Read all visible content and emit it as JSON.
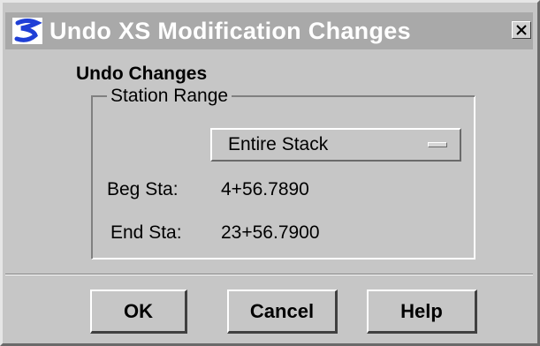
{
  "window": {
    "title": "Undo XS Modification Changes",
    "icon": "app-logo-icon",
    "close_glyph": "×"
  },
  "section": {
    "title": "Undo Changes"
  },
  "station_range": {
    "legend": "Station Range",
    "dropdown": {
      "selected": "Entire Stack"
    },
    "fields": [
      {
        "label": "Beg Sta:",
        "value": "4+56.7890"
      },
      {
        "label": "End Sta:",
        "value": "23+56.7900"
      }
    ]
  },
  "buttons": {
    "ok": "OK",
    "cancel": "Cancel",
    "help": "Help"
  },
  "colors": {
    "titlebar": "#a9a9a9",
    "dialog_bg": "#c6c6c6",
    "icon_blue": "#1f3fd6"
  }
}
